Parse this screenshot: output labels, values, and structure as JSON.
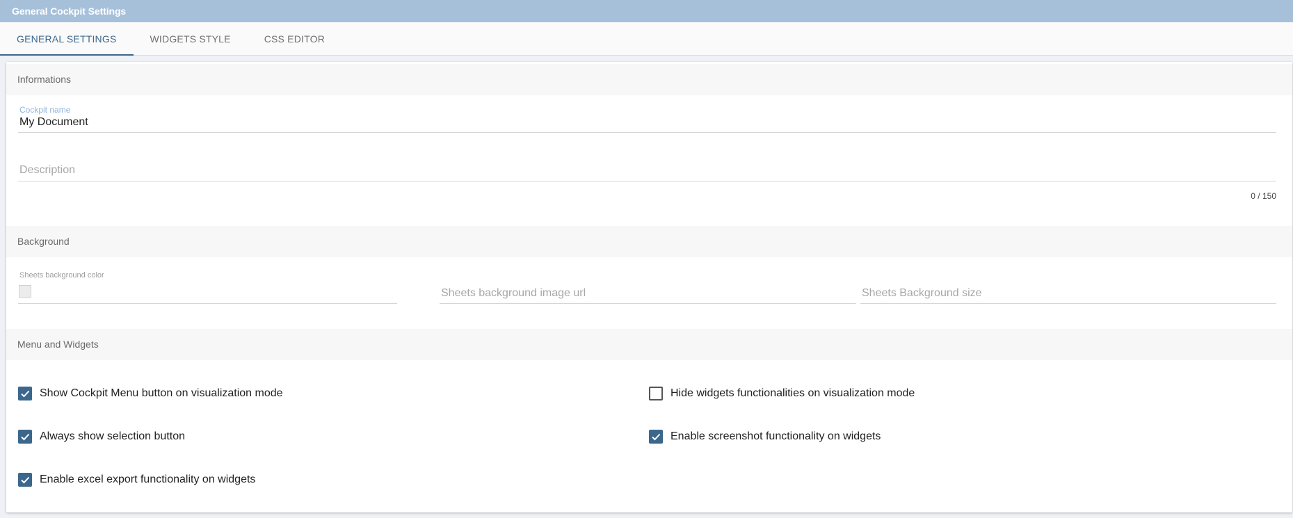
{
  "window": {
    "title": "General Cockpit Settings"
  },
  "tabs": [
    {
      "label": "GENERAL SETTINGS",
      "active": true
    },
    {
      "label": "WIDGETS STYLE",
      "active": false
    },
    {
      "label": "CSS EDITOR",
      "active": false
    }
  ],
  "informations": {
    "header": "Informations",
    "cockpit_name_label": "Cockpit name",
    "cockpit_name_value": "My Document",
    "description_placeholder": "Description",
    "description_counter": "0 / 150"
  },
  "background": {
    "header": "Background",
    "color_label": "Sheets background color",
    "image_url_placeholder": "Sheets background image url",
    "size_placeholder": "Sheets Background size"
  },
  "menu_widgets": {
    "header": "Menu and Widgets",
    "options": [
      {
        "label": "Show Cockpit Menu button on visualization mode",
        "checked": true
      },
      {
        "label": "Hide widgets functionalities on visualization mode",
        "checked": false
      },
      {
        "label": "Always show selection button",
        "checked": true
      },
      {
        "label": "Enable screenshot functionality on widgets",
        "checked": true
      },
      {
        "label": "Enable excel export functionality on widgets",
        "checked": true
      }
    ]
  },
  "colors": {
    "titlebar": "#a6c0da",
    "accent": "#3b678c",
    "label_blue": "#8fb4dc"
  }
}
